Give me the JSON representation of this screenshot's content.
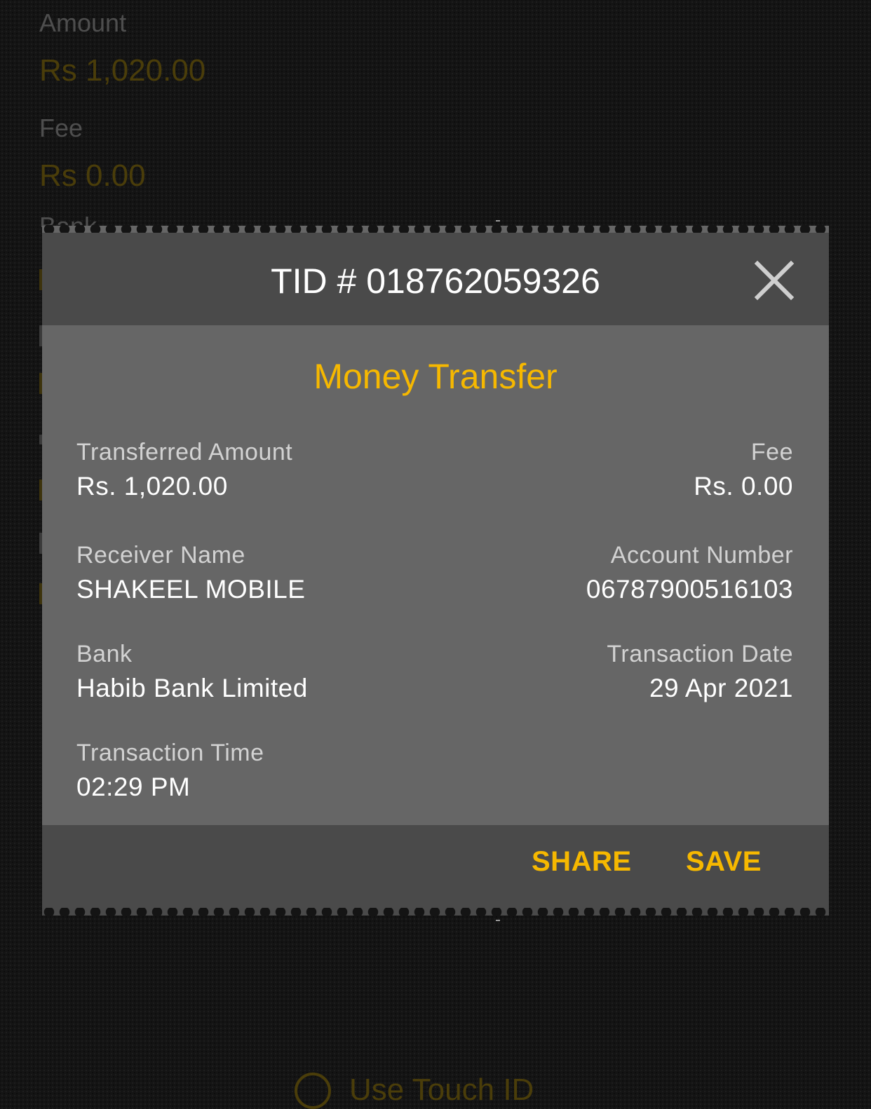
{
  "background": {
    "amount_label": "Amount",
    "amount_value": "Rs 1,020.00",
    "fee_label": "Fee",
    "fee_value": "Rs 0.00",
    "bank_label_fragment": "Bank",
    "touch_id_label": "Use Touch ID"
  },
  "receipt": {
    "tid": "TID # 018762059326",
    "title": "Money Transfer",
    "fields": {
      "transferred_amount_label": "Transferred Amount",
      "transferred_amount_value": "Rs. 1,020.00",
      "fee_label": "Fee",
      "fee_value": "Rs. 0.00",
      "receiver_name_label": "Receiver Name",
      "receiver_name_value": "SHAKEEL MOBILE",
      "account_number_label": "Account Number",
      "account_number_value": "06787900516103",
      "bank_label": "Bank",
      "bank_value": "Habib Bank Limited",
      "transaction_date_label": "Transaction Date",
      "transaction_date_value": "29 Apr 2021",
      "transaction_time_label": "Transaction Time",
      "transaction_time_value": "02:29 PM"
    },
    "actions": {
      "share_label": "SHARE",
      "save_label": "SAVE"
    },
    "icons": {
      "close": "close-icon"
    }
  },
  "colors": {
    "accent": "#f6b800",
    "header_bg": "#4a4a4a",
    "body_bg": "#666666",
    "screen_bg": "#141414"
  }
}
